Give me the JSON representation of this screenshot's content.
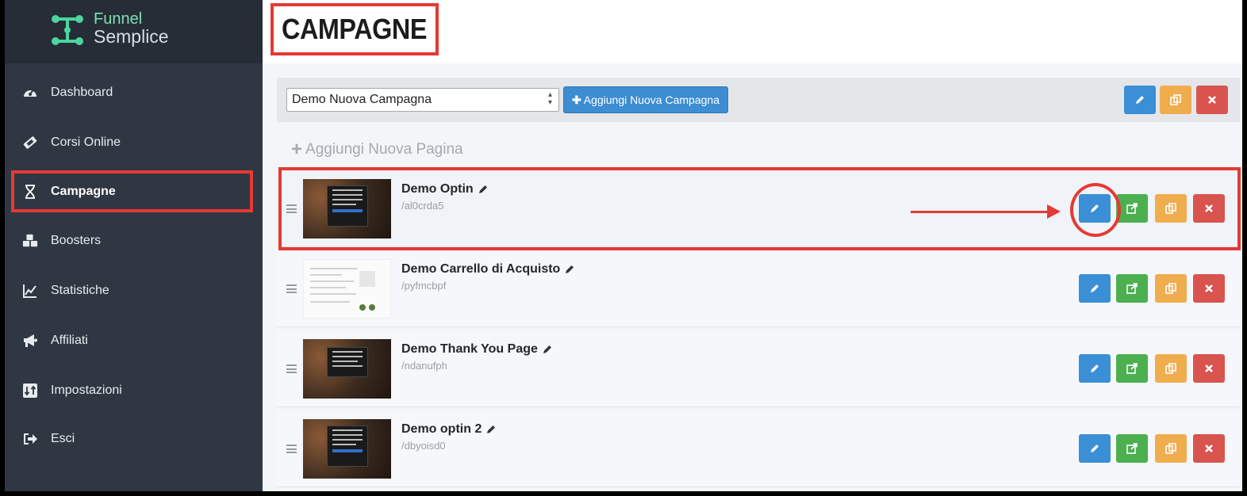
{
  "brand": {
    "line1": "Funnel",
    "line2": "Semplice",
    "accent": "#7ee0b6"
  },
  "sidebar": {
    "items": [
      {
        "label": "Dashboard",
        "icon": "dashboard-gauge-icon"
      },
      {
        "label": "Corsi Online",
        "icon": "ticket-icon"
      },
      {
        "label": "Campagne",
        "icon": "hourglass-icon",
        "active": true
      },
      {
        "label": "Boosters",
        "icon": "cubes-icon"
      },
      {
        "label": "Statistiche",
        "icon": "line-chart-icon"
      },
      {
        "label": "Affiliati",
        "icon": "megaphone-icon"
      },
      {
        "label": "Impostazioni",
        "icon": "sort-icon"
      },
      {
        "label": "Esci",
        "icon": "sign-out-icon"
      }
    ]
  },
  "page": {
    "title": "CAMPAGNE"
  },
  "toolbar": {
    "campaign_select": "Demo Nuova Campagna",
    "add_campaign_label": "Aggiungi Nuova Campagna"
  },
  "add_page_label": "Aggiungi Nuova Pagina",
  "pages": [
    {
      "title": "Demo Optin",
      "slug": "/al0crda5",
      "thumb": "dark"
    },
    {
      "title": "Demo Carrello di Acquisto",
      "slug": "/pyfmcbpf",
      "thumb": "light"
    },
    {
      "title": "Demo Thank You Page",
      "slug": "/ndanufph",
      "thumb": "dark"
    },
    {
      "title": "Demo optin 2",
      "slug": "/dbyoisd0",
      "thumb": "dark"
    }
  ],
  "colors": {
    "primary": "#3a8fd6",
    "success": "#4caf50",
    "warning": "#f0ad4e",
    "danger": "#d9534f",
    "annotation": "#e53935"
  }
}
